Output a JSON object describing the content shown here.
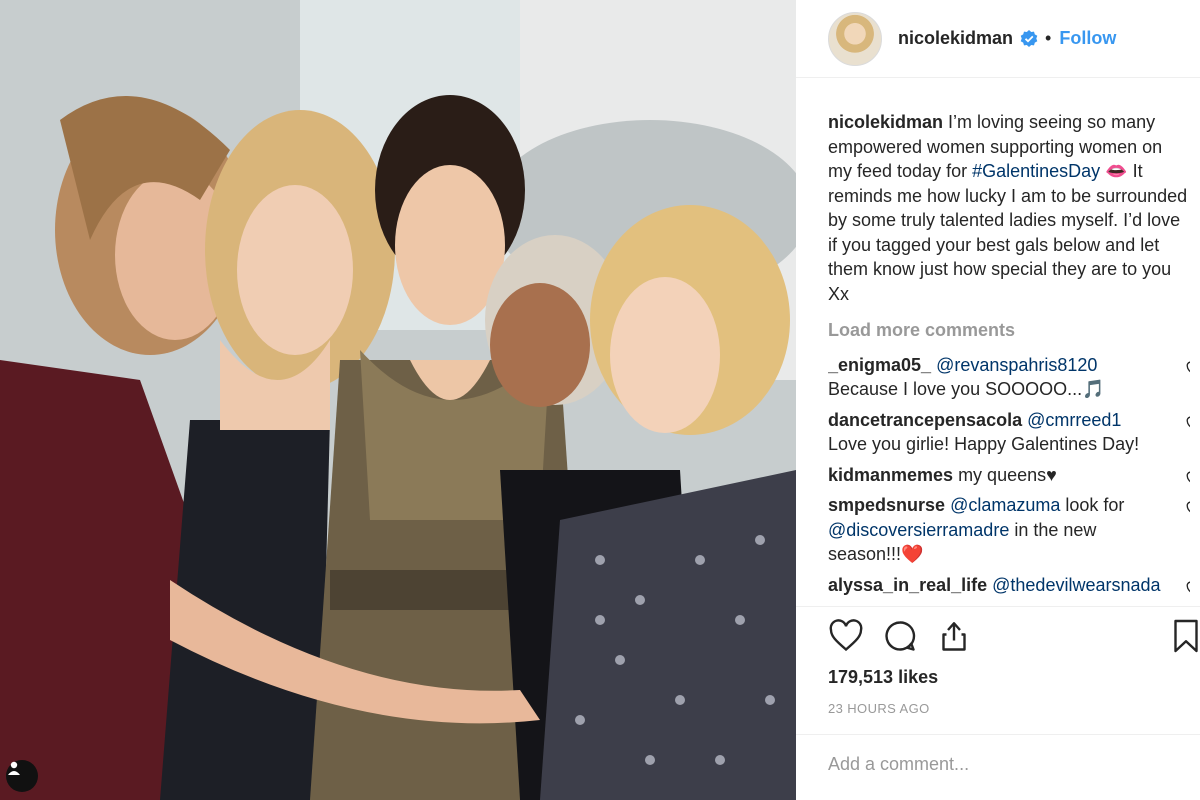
{
  "post": {
    "author": "nicolekidman",
    "follow_label": "Follow",
    "separator": "•",
    "caption": {
      "user": "nicolekidman",
      "text_before": " I’m loving seeing so many empowered women supporting women on my feed today for ",
      "hashtag": "#GalentinesDay",
      "emoji": "👄",
      "text_after": " It reminds me how lucky I am to be surrounded by some truly talented ladies myself. I’d love if you tagged your best gals below and let them know just how special they are to you Xx"
    },
    "load_more_label": "Load more comments",
    "comments": [
      {
        "user": "_enigma05_",
        "mention": "@revanspahris8120",
        "text": "Because I love you SOOOOO...🎵"
      },
      {
        "user": "dancetrancepensacola",
        "mention": "@cmrreed1",
        "text": "Love you girlie! Happy Galentines Day!"
      },
      {
        "user": "kidmanmemes",
        "mention": "",
        "text": " my queens♥"
      },
      {
        "user": "smpedsnurse",
        "mention": "@clamazuma",
        "text": " look for",
        "mention2": "@discoversierramadre",
        "text2": " in the new season!!!❤️"
      },
      {
        "user": "alyssa_in_real_life",
        "mention": "@thedevilwearsnada",
        "text": ""
      }
    ],
    "likes": "179,513 likes",
    "timestamp": "23 HOURS AGO",
    "add_comment_placeholder": "Add a comment..."
  },
  "icons": {
    "verified": "verified-badge-icon",
    "like": "heart-icon",
    "comment": "comment-icon",
    "share": "share-icon",
    "save": "bookmark-icon",
    "tag": "person-tag-icon"
  },
  "colors": {
    "link_blue": "#3897f0",
    "mention": "#003569",
    "muted": "#999999",
    "text": "#262626"
  }
}
